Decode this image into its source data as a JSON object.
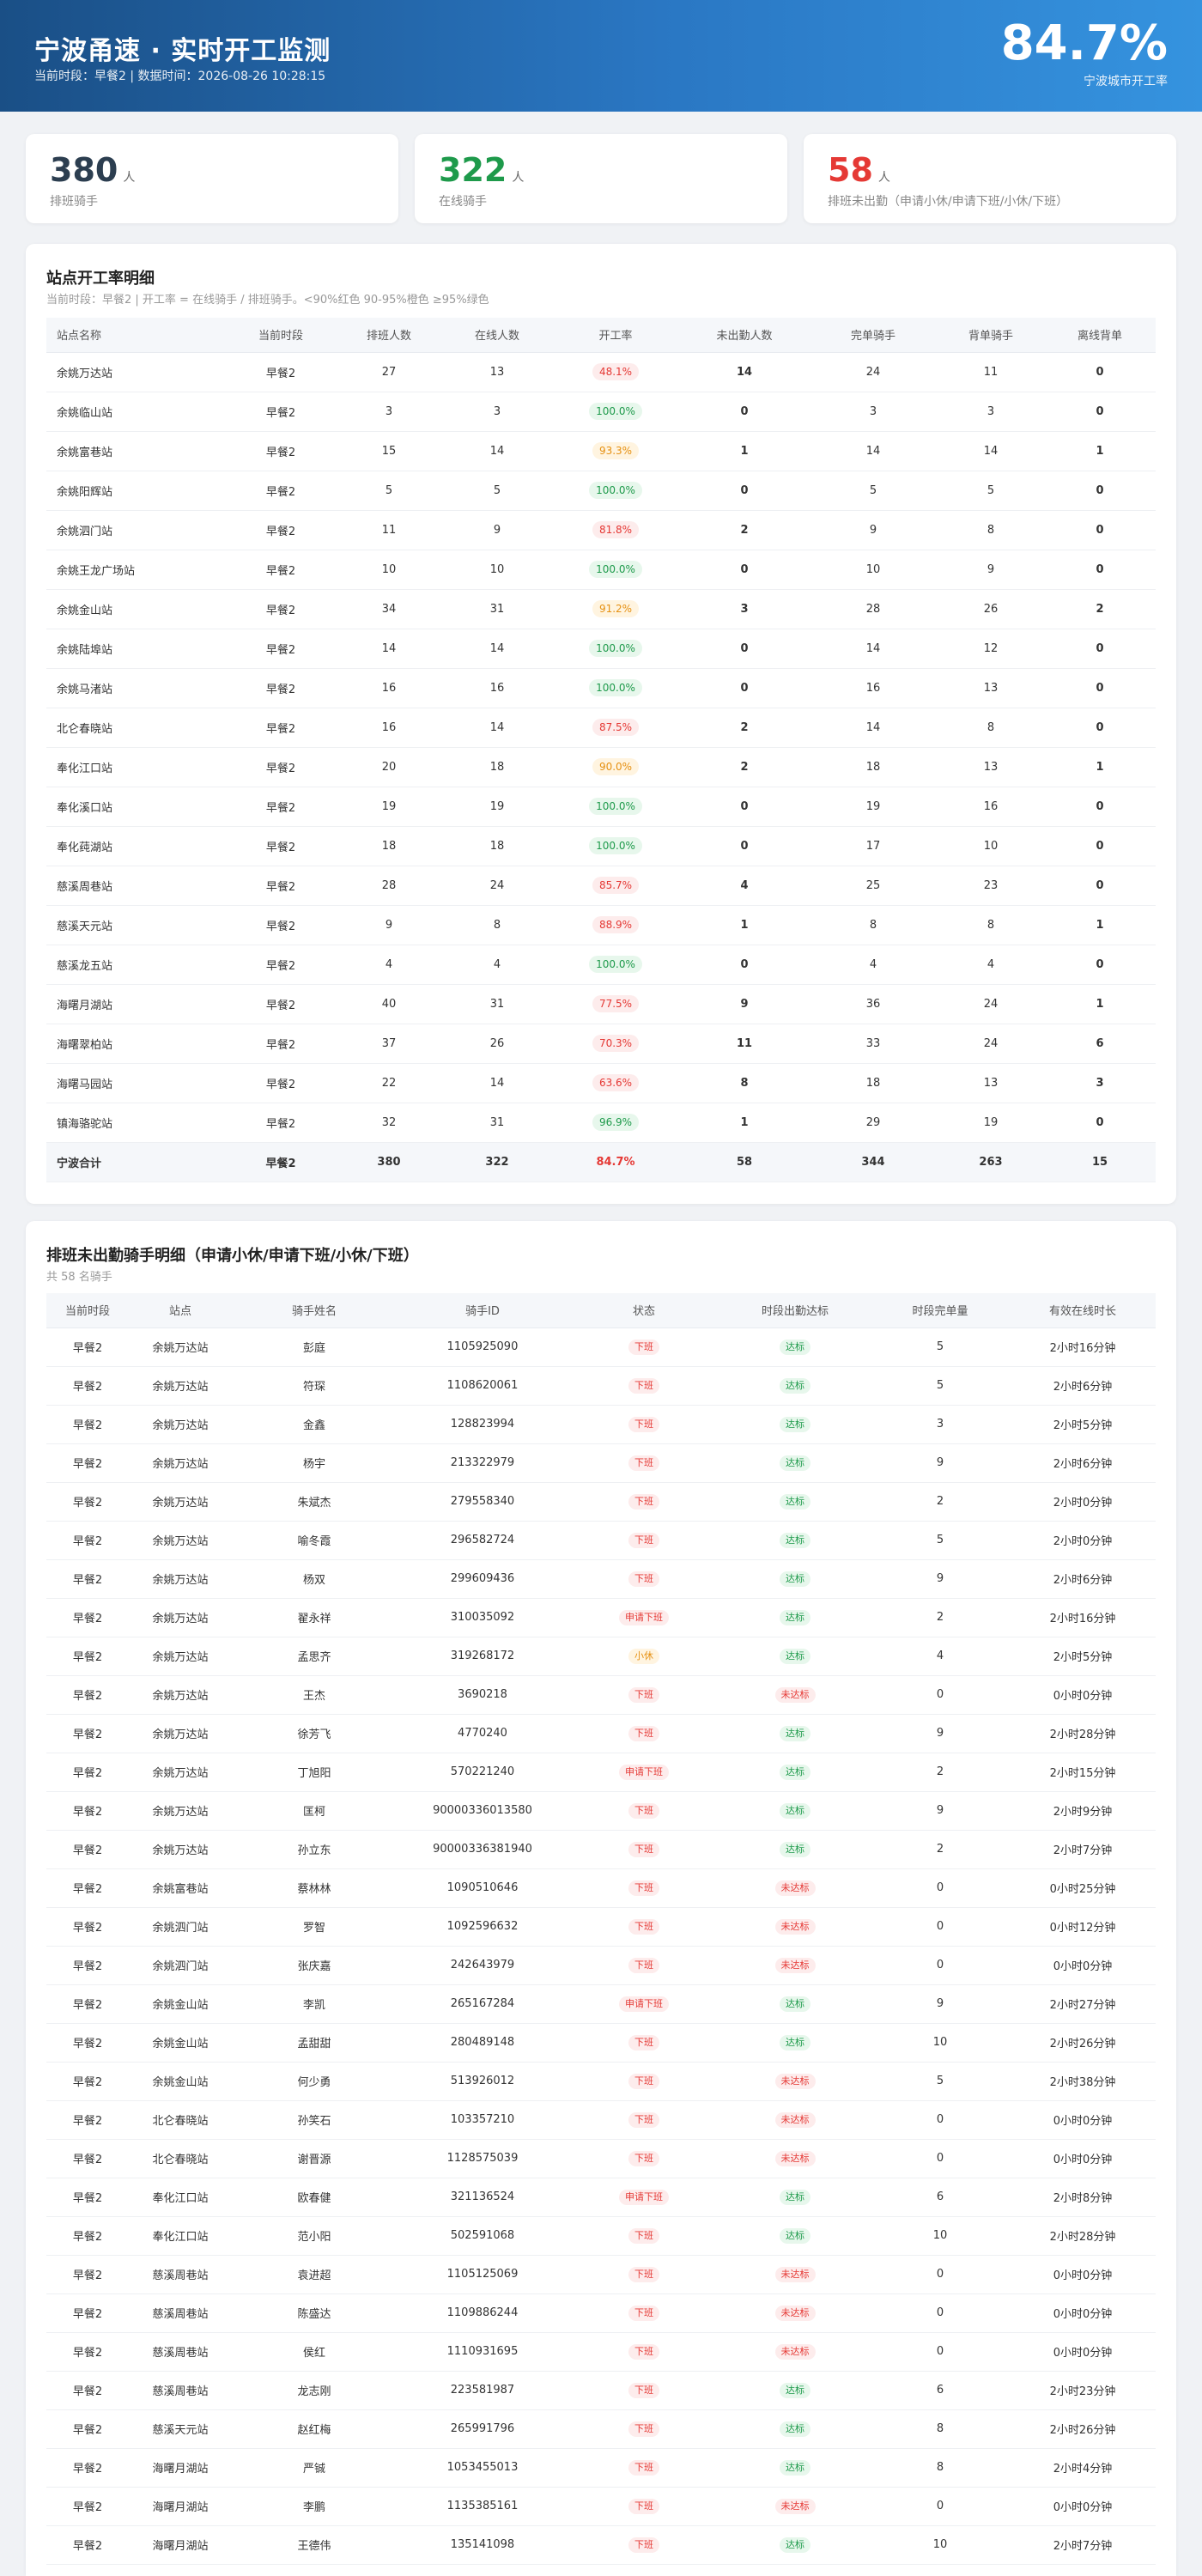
{
  "header": {
    "title": "宁波甬速 · 实时开工监测",
    "subtitle": "当前时段：早餐2 | 数据时间：2026-08-26 10:28:15",
    "rate": "84.7%",
    "rate_label": "宁波城市开工率"
  },
  "cards": [
    {
      "value": "380",
      "unit": "人",
      "label": "排班骑手",
      "color": "#2c3e50"
    },
    {
      "value": "322",
      "unit": "人",
      "label": "在线骑手",
      "color": "#1e9a4b"
    },
    {
      "value": "58",
      "unit": "人",
      "label": "排班未出勤（申请小休/申请下班/小休/下班）",
      "color": "#e53935"
    }
  ],
  "stations": {
    "title": "站点开工率明细",
    "subtitle": "当前时段：早餐2 | 开工率 = 在线骑手 / 排班骑手。<90%红色 90-95%橙色 ≥95%绿色",
    "columns": [
      "站点名称",
      "当前时段",
      "排班人数",
      "在线人数",
      "开工率",
      "未出勤人数",
      "完单骑手",
      "背单骑手",
      "离线背单"
    ],
    "rows": [
      {
        "name": "余姚万达站",
        "period": "早餐2",
        "scheduled": "27",
        "online": "13",
        "rate": "48.1%",
        "rate_level": "red",
        "absent": "14",
        "done": "24",
        "carry": "11",
        "offline_carry": "0"
      },
      {
        "name": "余姚临山站",
        "period": "早餐2",
        "scheduled": "3",
        "online": "3",
        "rate": "100.0%",
        "rate_level": "green",
        "absent": "0",
        "done": "3",
        "carry": "3",
        "offline_carry": "0"
      },
      {
        "name": "余姚富巷站",
        "period": "早餐2",
        "scheduled": "15",
        "online": "14",
        "rate": "93.3%",
        "rate_level": "orange",
        "absent": "1",
        "done": "14",
        "carry": "14",
        "offline_carry": "1"
      },
      {
        "name": "余姚阳辉站",
        "period": "早餐2",
        "scheduled": "5",
        "online": "5",
        "rate": "100.0%",
        "rate_level": "green",
        "absent": "0",
        "done": "5",
        "carry": "5",
        "offline_carry": "0"
      },
      {
        "name": "余姚泗门站",
        "period": "早餐2",
        "scheduled": "11",
        "online": "9",
        "rate": "81.8%",
        "rate_level": "red",
        "absent": "2",
        "done": "9",
        "carry": "8",
        "offline_carry": "0"
      },
      {
        "name": "余姚王龙广场站",
        "period": "早餐2",
        "scheduled": "10",
        "online": "10",
        "rate": "100.0%",
        "rate_level": "green",
        "absent": "0",
        "done": "10",
        "carry": "9",
        "offline_carry": "0"
      },
      {
        "name": "余姚金山站",
        "period": "早餐2",
        "scheduled": "34",
        "online": "31",
        "rate": "91.2%",
        "rate_level": "orange",
        "absent": "3",
        "done": "28",
        "carry": "26",
        "offline_carry": "2"
      },
      {
        "name": "余姚陆埠站",
        "period": "早餐2",
        "scheduled": "14",
        "online": "14",
        "rate": "100.0%",
        "rate_level": "green",
        "absent": "0",
        "done": "14",
        "carry": "12",
        "offline_carry": "0"
      },
      {
        "name": "余姚马渚站",
        "period": "早餐2",
        "scheduled": "16",
        "online": "16",
        "rate": "100.0%",
        "rate_level": "green",
        "absent": "0",
        "done": "16",
        "carry": "13",
        "offline_carry": "0"
      },
      {
        "name": "北仑春晓站",
        "period": "早餐2",
        "scheduled": "16",
        "online": "14",
        "rate": "87.5%",
        "rate_level": "red",
        "absent": "2",
        "done": "14",
        "carry": "8",
        "offline_carry": "0"
      },
      {
        "name": "奉化江口站",
        "period": "早餐2",
        "scheduled": "20",
        "online": "18",
        "rate": "90.0%",
        "rate_level": "orange",
        "absent": "2",
        "done": "18",
        "carry": "13",
        "offline_carry": "1"
      },
      {
        "name": "奉化溪口站",
        "period": "早餐2",
        "scheduled": "19",
        "online": "19",
        "rate": "100.0%",
        "rate_level": "green",
        "absent": "0",
        "done": "19",
        "carry": "16",
        "offline_carry": "0"
      },
      {
        "name": "奉化莼湖站",
        "period": "早餐2",
        "scheduled": "18",
        "online": "18",
        "rate": "100.0%",
        "rate_level": "green",
        "absent": "0",
        "done": "17",
        "carry": "10",
        "offline_carry": "0"
      },
      {
        "name": "慈溪周巷站",
        "period": "早餐2",
        "scheduled": "28",
        "online": "24",
        "rate": "85.7%",
        "rate_level": "red",
        "absent": "4",
        "done": "25",
        "carry": "23",
        "offline_carry": "0"
      },
      {
        "name": "慈溪天元站",
        "period": "早餐2",
        "scheduled": "9",
        "online": "8",
        "rate": "88.9%",
        "rate_level": "red",
        "absent": "1",
        "done": "8",
        "carry": "8",
        "offline_carry": "1"
      },
      {
        "name": "慈溪龙五站",
        "period": "早餐2",
        "scheduled": "4",
        "online": "4",
        "rate": "100.0%",
        "rate_level": "green",
        "absent": "0",
        "done": "4",
        "carry": "4",
        "offline_carry": "0"
      },
      {
        "name": "海曙月湖站",
        "period": "早餐2",
        "scheduled": "40",
        "online": "31",
        "rate": "77.5%",
        "rate_level": "red",
        "absent": "9",
        "done": "36",
        "carry": "24",
        "offline_carry": "1"
      },
      {
        "name": "海曙翠柏站",
        "period": "早餐2",
        "scheduled": "37",
        "online": "26",
        "rate": "70.3%",
        "rate_level": "red",
        "absent": "11",
        "done": "33",
        "carry": "24",
        "offline_carry": "6"
      },
      {
        "name": "海曙马园站",
        "period": "早餐2",
        "scheduled": "22",
        "online": "14",
        "rate": "63.6%",
        "rate_level": "red",
        "absent": "8",
        "done": "18",
        "carry": "13",
        "offline_carry": "3"
      },
      {
        "name": "镇海骆驼站",
        "period": "早餐2",
        "scheduled": "32",
        "online": "31",
        "rate": "96.9%",
        "rate_level": "green",
        "absent": "1",
        "done": "29",
        "carry": "19",
        "offline_carry": "0"
      }
    ],
    "total": {
      "name": "宁波合计",
      "period": "早餐2",
      "scheduled": "380",
      "online": "322",
      "rate": "84.7%",
      "absent": "58",
      "done": "344",
      "carry": "263",
      "offline_carry": "15"
    }
  },
  "riders": {
    "title": "排班未出勤骑手明细（申请小休/申请下班/小休/下班）",
    "subtitle": "共 58 名骑手",
    "columns": [
      "当前时段",
      "站点",
      "骑手姓名",
      "骑手ID",
      "状态",
      "时段出勤达标",
      "时段完单量",
      "有效在线时长"
    ],
    "rows": [
      {
        "period": "早餐2",
        "station": "余姚万达站",
        "name": "彭庭",
        "id": "1105925090",
        "status": "下班",
        "status_type": "off",
        "attend": "达标",
        "attend_ok": true,
        "orders": "5",
        "duration": "2小时16分钟"
      },
      {
        "period": "早餐2",
        "station": "余姚万达站",
        "name": "符琛",
        "id": "1108620061",
        "status": "下班",
        "status_type": "off",
        "attend": "达标",
        "attend_ok": true,
        "orders": "5",
        "duration": "2小时6分钟"
      },
      {
        "period": "早餐2",
        "station": "余姚万达站",
        "name": "金鑫",
        "id": "128823994",
        "status": "下班",
        "status_type": "off",
        "attend": "达标",
        "attend_ok": true,
        "orders": "3",
        "duration": "2小时5分钟"
      },
      {
        "period": "早餐2",
        "station": "余姚万达站",
        "name": "杨宇",
        "id": "213322979",
        "status": "下班",
        "status_type": "off",
        "attend": "达标",
        "attend_ok": true,
        "orders": "9",
        "duration": "2小时6分钟"
      },
      {
        "period": "早餐2",
        "station": "余姚万达站",
        "name": "朱斌杰",
        "id": "279558340",
        "status": "下班",
        "status_type": "off",
        "attend": "达标",
        "attend_ok": true,
        "orders": "2",
        "duration": "2小时0分钟"
      },
      {
        "period": "早餐2",
        "station": "余姚万达站",
        "name": "喻冬霞",
        "id": "296582724",
        "status": "下班",
        "status_type": "off",
        "attend": "达标",
        "attend_ok": true,
        "orders": "5",
        "duration": "2小时0分钟"
      },
      {
        "period": "早餐2",
        "station": "余姚万达站",
        "name": "杨双",
        "id": "299609436",
        "status": "下班",
        "status_type": "off",
        "attend": "达标",
        "attend_ok": true,
        "orders": "9",
        "duration": "2小时6分钟"
      },
      {
        "period": "早餐2",
        "station": "余姚万达站",
        "name": "翟永祥",
        "id": "310035092",
        "status": "申请下班",
        "status_type": "req",
        "attend": "达标",
        "attend_ok": true,
        "orders": "2",
        "duration": "2小时16分钟"
      },
      {
        "period": "早餐2",
        "station": "余姚万达站",
        "name": "孟思齐",
        "id": "319268172",
        "status": "小休",
        "status_type": "rest",
        "attend": "达标",
        "attend_ok": true,
        "orders": "4",
        "duration": "2小时5分钟"
      },
      {
        "period": "早餐2",
        "station": "余姚万达站",
        "name": "王杰",
        "id": "3690218",
        "status": "下班",
        "status_type": "off",
        "attend": "未达标",
        "attend_ok": false,
        "orders": "0",
        "duration": "0小时0分钟"
      },
      {
        "period": "早餐2",
        "station": "余姚万达站",
        "name": "徐芳飞",
        "id": "4770240",
        "status": "下班",
        "status_type": "off",
        "attend": "达标",
        "attend_ok": true,
        "orders": "9",
        "duration": "2小时28分钟"
      },
      {
        "period": "早餐2",
        "station": "余姚万达站",
        "name": "丁旭阳",
        "id": "570221240",
        "status": "申请下班",
        "status_type": "req",
        "attend": "达标",
        "attend_ok": true,
        "orders": "2",
        "duration": "2小时15分钟"
      },
      {
        "period": "早餐2",
        "station": "余姚万达站",
        "name": "匡柯",
        "id": "90000336013580",
        "status": "下班",
        "status_type": "off",
        "attend": "达标",
        "attend_ok": true,
        "orders": "9",
        "duration": "2小时9分钟"
      },
      {
        "period": "早餐2",
        "station": "余姚万达站",
        "name": "孙立东",
        "id": "90000336381940",
        "status": "下班",
        "status_type": "off",
        "attend": "达标",
        "attend_ok": true,
        "orders": "2",
        "duration": "2小时7分钟"
      },
      {
        "period": "早餐2",
        "station": "余姚富巷站",
        "name": "蔡林林",
        "id": "1090510646",
        "status": "下班",
        "status_type": "off",
        "attend": "未达标",
        "attend_ok": false,
        "orders": "0",
        "duration": "0小时25分钟"
      },
      {
        "period": "早餐2",
        "station": "余姚泗门站",
        "name": "罗智",
        "id": "1092596632",
        "status": "下班",
        "status_type": "off",
        "attend": "未达标",
        "attend_ok": false,
        "orders": "0",
        "duration": "0小时12分钟"
      },
      {
        "period": "早餐2",
        "station": "余姚泗门站",
        "name": "张庆嘉",
        "id": "242643979",
        "status": "下班",
        "status_type": "off",
        "attend": "未达标",
        "attend_ok": false,
        "orders": "0",
        "duration": "0小时0分钟"
      },
      {
        "period": "早餐2",
        "station": "余姚金山站",
        "name": "李凯",
        "id": "265167284",
        "status": "申请下班",
        "status_type": "req",
        "attend": "达标",
        "attend_ok": true,
        "orders": "9",
        "duration": "2小时27分钟"
      },
      {
        "period": "早餐2",
        "station": "余姚金山站",
        "name": "孟甜甜",
        "id": "280489148",
        "status": "下班",
        "status_type": "off",
        "attend": "达标",
        "attend_ok": true,
        "orders": "10",
        "duration": "2小时26分钟"
      },
      {
        "period": "早餐2",
        "station": "余姚金山站",
        "name": "何少勇",
        "id": "513926012",
        "status": "下班",
        "status_type": "off",
        "attend": "未达标",
        "attend_ok": false,
        "orders": "5",
        "duration": "2小时38分钟"
      },
      {
        "period": "早餐2",
        "station": "北仑春晓站",
        "name": "孙笑石",
        "id": "103357210",
        "status": "下班",
        "status_type": "off",
        "attend": "未达标",
        "attend_ok": false,
        "orders": "0",
        "duration": "0小时0分钟"
      },
      {
        "period": "早餐2",
        "station": "北仑春晓站",
        "name": "谢晋源",
        "id": "1128575039",
        "status": "下班",
        "status_type": "off",
        "attend": "未达标",
        "attend_ok": false,
        "orders": "0",
        "duration": "0小时0分钟"
      },
      {
        "period": "早餐2",
        "station": "奉化江口站",
        "name": "欧春健",
        "id": "321136524",
        "status": "申请下班",
        "status_type": "req",
        "attend": "达标",
        "attend_ok": true,
        "orders": "6",
        "duration": "2小时8分钟"
      },
      {
        "period": "早餐2",
        "station": "奉化江口站",
        "name": "范小阳",
        "id": "502591068",
        "status": "下班",
        "status_type": "off",
        "attend": "达标",
        "attend_ok": true,
        "orders": "10",
        "duration": "2小时28分钟"
      },
      {
        "period": "早餐2",
        "station": "慈溪周巷站",
        "name": "袁进超",
        "id": "1105125069",
        "status": "下班",
        "status_type": "off",
        "attend": "未达标",
        "attend_ok": false,
        "orders": "0",
        "duration": "0小时0分钟"
      },
      {
        "period": "早餐2",
        "station": "慈溪周巷站",
        "name": "陈盛达",
        "id": "1109886244",
        "status": "下班",
        "status_type": "off",
        "attend": "未达标",
        "attend_ok": false,
        "orders": "0",
        "duration": "0小时0分钟"
      },
      {
        "period": "早餐2",
        "station": "慈溪周巷站",
        "name": "侯红",
        "id": "1110931695",
        "status": "下班",
        "status_type": "off",
        "attend": "未达标",
        "attend_ok": false,
        "orders": "0",
        "duration": "0小时0分钟"
      },
      {
        "period": "早餐2",
        "station": "慈溪周巷站",
        "name": "龙志刚",
        "id": "223581987",
        "status": "下班",
        "status_type": "off",
        "attend": "达标",
        "attend_ok": true,
        "orders": "6",
        "duration": "2小时23分钟"
      },
      {
        "period": "早餐2",
        "station": "慈溪天元站",
        "name": "赵红梅",
        "id": "265991796",
        "status": "下班",
        "status_type": "off",
        "attend": "达标",
        "attend_ok": true,
        "orders": "8",
        "duration": "2小时26分钟"
      },
      {
        "period": "早餐2",
        "station": "海曙月湖站",
        "name": "严铖",
        "id": "1053455013",
        "status": "下班",
        "status_type": "off",
        "attend": "达标",
        "attend_ok": true,
        "orders": "8",
        "duration": "2小时4分钟"
      },
      {
        "period": "早餐2",
        "station": "海曙月湖站",
        "name": "李鹏",
        "id": "1135385161",
        "status": "下班",
        "status_type": "off",
        "attend": "未达标",
        "attend_ok": false,
        "orders": "0",
        "duration": "0小时0分钟"
      },
      {
        "period": "早餐2",
        "station": "海曙月湖站",
        "name": "王德伟",
        "id": "135141098",
        "status": "下班",
        "status_type": "off",
        "attend": "达标",
        "attend_ok": true,
        "orders": "10",
        "duration": "2小时7分钟"
      }
    ]
  }
}
